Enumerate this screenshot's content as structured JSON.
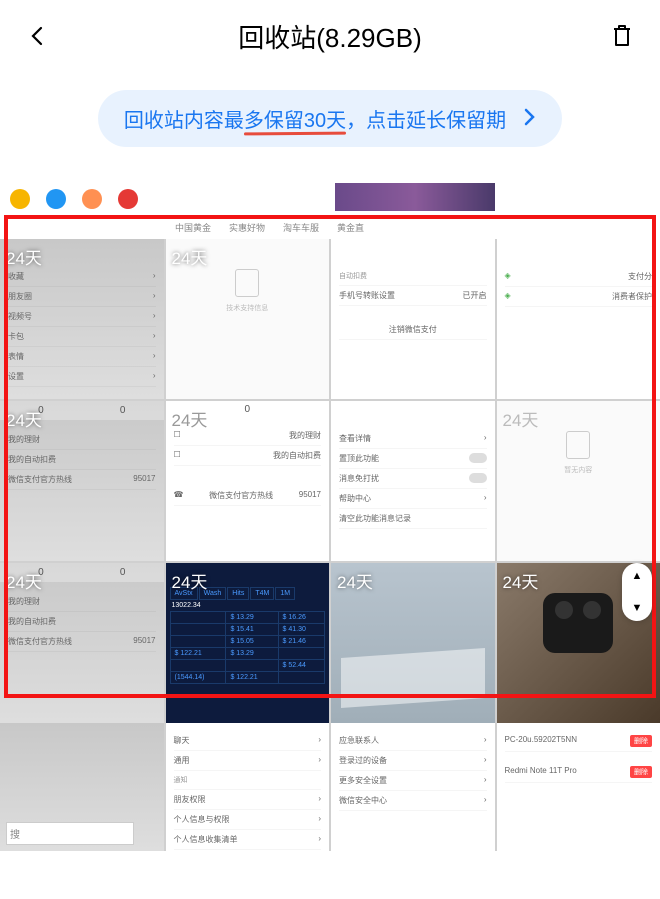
{
  "header": {
    "title": "回收站(8.29GB)"
  },
  "banner": {
    "text": "回收站内容最多保留30天，点击延长保留期"
  },
  "icon_row": {
    "colors": [
      "#f7b500",
      "#2196f3",
      "#ff5252",
      "#e53935"
    ]
  },
  "tab_row": [
    "中国黄金",
    "实惠好物",
    "淘车车服",
    "黄金直"
  ],
  "days_label": "24天",
  "tile_r1c1": {
    "items": [
      "收藏",
      "朋友圈",
      "视频号",
      "卡包",
      "表情",
      "设置"
    ]
  },
  "tile_r1c2": {
    "caption": "技术支持信息"
  },
  "tile_r1c3": {
    "heading": "自动扣费",
    "line1_label": "手机号转账设置",
    "line1_value": "已开启",
    "line2_label": "注销微信支付"
  },
  "tile_r1c4": {
    "line1": "支付分",
    "line2": "消费者保护"
  },
  "tile_r2c1": {
    "header_vals": [
      "0",
      "0"
    ],
    "items": [
      "我的理财",
      "我的自动扣费",
      "微信支付官方热线",
      "95017"
    ]
  },
  "tile_r2c2": {
    "header_val": "0",
    "items": [
      "我的理财",
      "我的自动扣费",
      "微信支付官方热线",
      "95017"
    ]
  },
  "tile_r2c3": {
    "items": [
      "查看详情",
      "置顶此功能",
      "消息免打扰",
      "帮助中心",
      "清空此功能消息记录"
    ]
  },
  "tile_r2c4": {
    "caption": "暂无内容"
  },
  "tile_r3c1": {
    "header_vals": [
      "0",
      "0"
    ],
    "items": [
      "我的理财",
      "我的自动扣费",
      "微信支付官方热线",
      "95017"
    ]
  },
  "tile_r3c2": {
    "headers": [
      "AvStx",
      "Wash",
      "Hits",
      "T4M",
      "1M"
    ],
    "top_val": "13022.34",
    "cells": [
      "$ 13.29",
      "$ 16.26",
      "$ 15.41",
      "$ 41.30",
      "$ 15.05",
      "$ 21.46",
      "$ 122.21",
      "$ 13.29",
      "$ 52.44",
      "(1544.14)",
      "$ 122.21"
    ]
  },
  "tile_r4c1": {
    "caption": "搜"
  },
  "tile_r4c2": {
    "items": [
      "聊天",
      "通用",
      "通知",
      "朋友权限",
      "个人信息与权限",
      "个人信息收集清单"
    ]
  },
  "tile_r4c3": {
    "items": [
      "应急联系人",
      "登录过的设备",
      "更多安全设置",
      "微信安全中心"
    ]
  },
  "tile_r4c4": {
    "device1": "PC-20u.59202T5NN",
    "device2": "Redmi Note 11T Pro",
    "tag": "删除"
  },
  "scroll_arrows": {
    "up": "▲",
    "down": "▼"
  }
}
